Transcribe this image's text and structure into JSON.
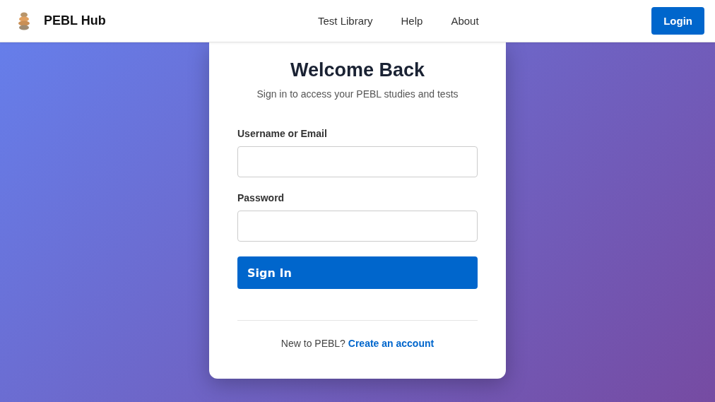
{
  "header": {
    "brand": "PEBL Hub",
    "nav": [
      {
        "label": "Test Library"
      },
      {
        "label": "Help"
      },
      {
        "label": "About"
      }
    ],
    "login_button": "Login"
  },
  "card": {
    "title": "Welcome Back",
    "subtitle": "Sign in to access your PEBL studies and tests",
    "fields": [
      {
        "label": "Username or Email"
      },
      {
        "label": "Password"
      }
    ],
    "submit": "Sign In",
    "footer_text": "New to PEBL?",
    "footer_link": "Create an account"
  }
}
